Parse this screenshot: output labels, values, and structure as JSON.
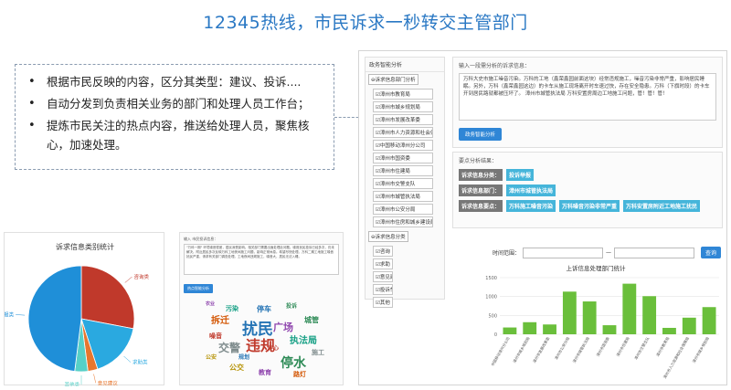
{
  "title": "12345热线，市民诉求一秒转交主管部门",
  "bullets": [
    "根据市民反映的内容，区分其类型：建议、投诉....",
    "自动分发到负责相关业务的部门和处理人员工作台；",
    "提炼市民关注的热点内容，推送给处理人员，聚焦核心，加速处理。"
  ],
  "tree": {
    "header": "政务智能分析",
    "group1": "诉求信息部门分析",
    "departments": [
      "漳州市教育局",
      "漳州市城乡规划局",
      "漳州市发展改革委",
      "漳州市人力资源和社会保障局",
      "中国移动漳州分公司",
      "漳州市国资委",
      "漳州市住建局",
      "漳州市交警支队",
      "漳州市城管执法局",
      "漳州市公安分局",
      "漳州市住房和城乡建设局"
    ],
    "group2": "诉求信息分类",
    "types": [
      "咨询",
      "求助",
      "意见建议",
      "投诉举报",
      "其他"
    ]
  },
  "input_box": {
    "label": "输入一段需分析的诉求信息：",
    "text": "万科大史市施工噪音污染。万科的工地（鑫荣鑫园前面这块）经常违规施工，噪音污染非常严重，影响居民睡眠。另外，万科（鑫荣鑫园这边）的卡车从施工现场离开时车速过快，存在安全隐患。万科（下旗时段）的卡车开到居民路就都被压坏了。     漳州市城管执法局\n万科安置房周边工地施工问题，管！管！管！",
    "button": "政务智能分析"
  },
  "result": {
    "label": "要点分析结果：",
    "rows": [
      {
        "key": "诉求信息分类：",
        "values": [
          "投诉举报"
        ]
      },
      {
        "key": "诉求信息部门：",
        "values": [
          "漳州市城管执法局"
        ]
      },
      {
        "key": "诉求信息要点：",
        "values": [
          "万科施工噪音污染",
          "万科噪音污染非常严重",
          "万科安置房附近工地施工扰民"
        ]
      }
    ]
  },
  "query": {
    "label": "时间范围：",
    "separator": "—",
    "button": "查询"
  },
  "bar_chart_title": "上诉信息处理部门统计",
  "pie_title": "诉求信息类别统计",
  "wordcloud": {
    "label": "输入 市民投诉信息：",
    "text": "\"万科一期\" 环境噪音很差，居民深受影响。相关部门需要出面处理此问题。噪音扰民投诉已经多次，仍未解决。附近居民多次反映万科工地夜间施工问题，影响正常休息。希望尽快处理。万科二期工地施工噪音扰民严重，请求有关部门调查处理。工地夜间违规施工，噪音大，居民无法入睡。",
    "button": "热点智能分析",
    "words": [
      "扰民",
      "违规",
      "停水",
      "广场",
      "拆迁",
      "执法局",
      "交警",
      "公交",
      "停车",
      "噪音",
      "城管",
      "教育",
      "路灯",
      "污染",
      "施工",
      "公安",
      "规划",
      "中心",
      "投诉",
      "农业"
    ]
  },
  "chart_data": [
    {
      "type": "pie",
      "title": "诉求信息类别统计",
      "labels": [
        "咨询类",
        "求助类",
        "意见建议",
        "其他类",
        "诉求举报类"
      ],
      "values": [
        28,
        17,
        3,
        4,
        48
      ],
      "colors": [
        "#c0392b",
        "#2aa9e0",
        "#e8762d",
        "#57d0c7",
        "#1f8fd8"
      ],
      "legend": "labels-outside"
    },
    {
      "type": "bar",
      "title": "上诉信息处理部门统计",
      "categories": [
        "中国移动漳州分公司",
        "漳州市城乡规划局",
        "漳州市发展改革委",
        "漳州市公安分局",
        "漳州市城管执法局",
        "漳州市国资委",
        "漳州市住建局",
        "漳州市交警支队",
        "漳州市教育局",
        "漳州市人力资源和社会保障局",
        "漳州市城乡规划局"
      ],
      "values": [
        180,
        320,
        260,
        1130,
        870,
        240,
        1340,
        1010,
        170,
        440,
        720
      ],
      "ylim": [
        0,
        1500
      ],
      "yticks": [
        0,
        500,
        1000,
        1500
      ],
      "color": "#6abf3b",
      "grid": true
    }
  ]
}
